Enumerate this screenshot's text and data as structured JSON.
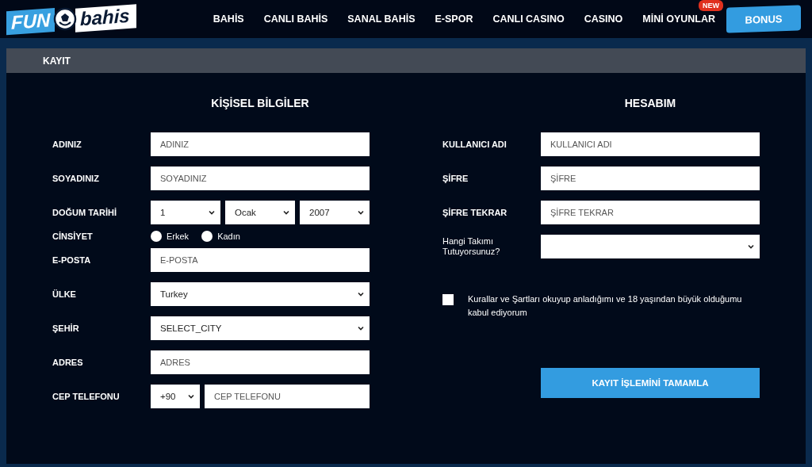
{
  "logo": {
    "left": "FUN",
    "right": "bahis"
  },
  "nav": [
    {
      "label": "BAHİS"
    },
    {
      "label": "CANLI BAHİS"
    },
    {
      "label": "SANAL BAHİS"
    },
    {
      "label": "E-SPOR"
    },
    {
      "label": "CANLI CASINO"
    },
    {
      "label": "CASINO"
    },
    {
      "label": "MİNİ OYUNLAR",
      "badge": "NEW"
    }
  ],
  "bonus_button": "BONUS",
  "page_title": "KAYIT",
  "personal": {
    "title": "KİŞİSEL BİLGİLER",
    "fields": [
      {
        "kind": "text",
        "label": "ADINIZ",
        "placeholder": "ADINIZ"
      },
      {
        "kind": "text",
        "label": "SOYADINIZ",
        "placeholder": "SOYADINIZ"
      },
      {
        "kind": "dates",
        "label": "DOĞUM TARİHİ",
        "values": [
          "1",
          "Ocak",
          "2007"
        ]
      },
      {
        "kind": "radio",
        "label": "CİNSİYET",
        "options": [
          {
            "label": "Erkek",
            "selected": false
          },
          {
            "label": "Kadın",
            "selected": false
          }
        ]
      },
      {
        "kind": "text",
        "label": "E-POSTA",
        "placeholder": "E-POSTA"
      },
      {
        "kind": "select",
        "label": "ÜLKE",
        "value": "Turkey"
      },
      {
        "kind": "select",
        "label": "ŞEHİR",
        "value": "SELECT_CITY"
      },
      {
        "kind": "text",
        "label": "ADRES",
        "placeholder": "ADRES"
      },
      {
        "kind": "phone",
        "label": "CEP TELEFONU",
        "code": "+90",
        "placeholder": "CEP TELEFONU"
      }
    ]
  },
  "account": {
    "title": "HESABIM",
    "fields": [
      {
        "kind": "text",
        "label": "KULLANICI ADI",
        "placeholder": "KULLANICI ADI"
      },
      {
        "kind": "text",
        "label": "ŞİFRE",
        "placeholder": "ŞİFRE"
      },
      {
        "kind": "text",
        "label": "ŞİFRE TEKRAR",
        "placeholder": "ŞİFRE TEKRAR"
      },
      {
        "kind": "select",
        "label": "Hangi Takımı Tutuyorsunuz?"
      }
    ],
    "terms": {
      "checked": false,
      "text": "Kurallar ve Şartları okuyup anladığımı ve 18 yaşından büyük olduğumu kabul ediyorum"
    },
    "submit": "KAYIT İŞLEMİNİ TAMAMLA"
  }
}
